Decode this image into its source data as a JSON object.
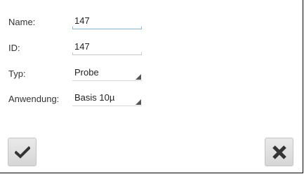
{
  "form": {
    "name": {
      "label": "Name:",
      "value": "147"
    },
    "id": {
      "label": "ID:",
      "value": "147"
    },
    "typ": {
      "label": "Typ:",
      "value": "Probe"
    },
    "anwendung": {
      "label": "Anwendung:",
      "value": "Basis 10µ"
    }
  },
  "buttons": {
    "confirm_icon": "checkmark-icon",
    "cancel_icon": "close-icon"
  }
}
